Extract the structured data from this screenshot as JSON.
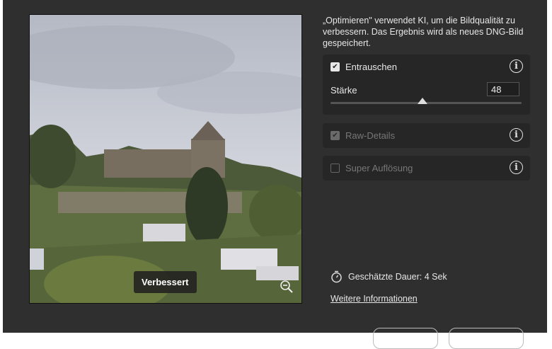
{
  "preview": {
    "badge_label": "Verbessert"
  },
  "description": "„Optimieren\" verwendet KI, um die Bildqualität zu verbessern. Das Ergebnis wird als neues DNG-Bild gespeichert.",
  "denoise": {
    "label": "Entrauschen",
    "checked": true,
    "strength_label": "Stärke",
    "strength_value": "48",
    "strength_percent": 48
  },
  "raw_details": {
    "label": "Raw-Details",
    "checked": true,
    "disabled": true
  },
  "super_resolution": {
    "label": "Super Auflösung",
    "checked": false,
    "disabled": true
  },
  "duration": "Geschätzte Dauer: 4 Sek",
  "more_info_link": "Weitere Informationen"
}
